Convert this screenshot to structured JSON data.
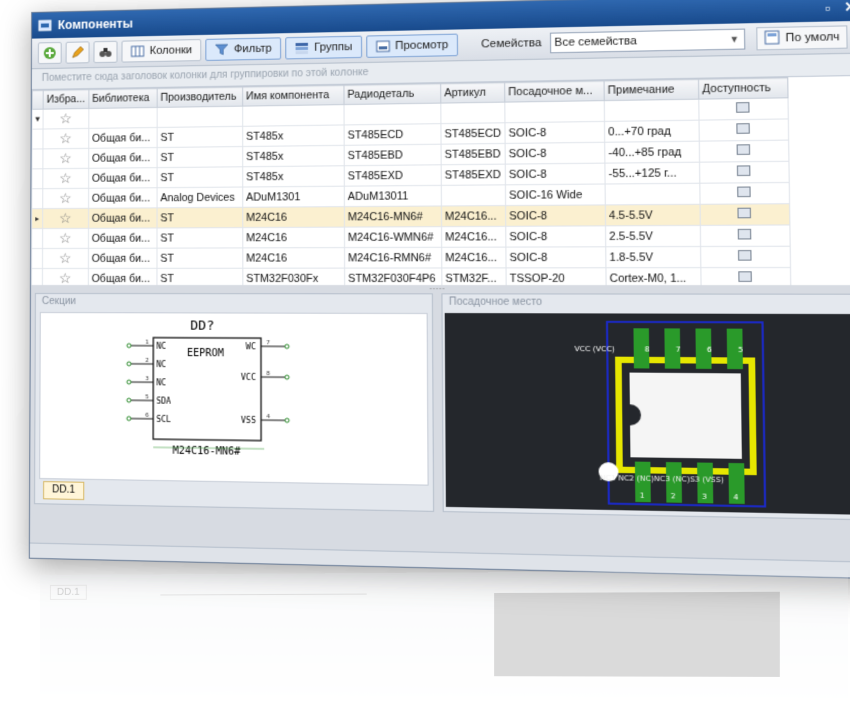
{
  "window": {
    "title": "Компоненты"
  },
  "toolbar": {
    "columns_label": "Колонки",
    "filter_label": "Фильтр",
    "groups_label": "Группы",
    "preview_label": "Просмотр",
    "families_label": "Семейства",
    "families_value": "Все семейства",
    "default_label": "По умолч"
  },
  "grid": {
    "group_hint": "Поместите сюда заголовок колонки для группировки по этой колонке",
    "columns": [
      "Избра...",
      "Библиотека",
      "Производитель",
      "Имя компонента",
      "Радиодеталь",
      "Артикул",
      "Посадочное м...",
      "Примечание",
      "Доступность"
    ],
    "rows": [
      [
        "Общая би...",
        "ST",
        "ST485x",
        "ST485ECD",
        "ST485ECD",
        "SOIC-8",
        "0...+70 град"
      ],
      [
        "Общая би...",
        "ST",
        "ST485x",
        "ST485EBD",
        "ST485EBD",
        "SOIC-8",
        "-40...+85 град"
      ],
      [
        "Общая би...",
        "ST",
        "ST485x",
        "ST485EXD",
        "ST485EXD",
        "SOIC-8",
        "-55...+125 г..."
      ],
      [
        "Общая би...",
        "Analog Devices",
        "ADuM1301",
        "ADuM13011",
        "",
        "SOIC-16 Wide",
        ""
      ],
      [
        "Общая би...",
        "ST",
        "M24C16",
        "M24C16-MN6#",
        "M24C16...",
        "SOIC-8",
        "4.5-5.5V"
      ],
      [
        "Общая би...",
        "ST",
        "M24C16",
        "M24C16-WMN6#",
        "M24C16...",
        "SOIC-8",
        "2.5-5.5V"
      ],
      [
        "Общая би...",
        "ST",
        "M24C16",
        "M24C16-RMN6#",
        "M24C16...",
        "SOIC-8",
        "1.8-5.5V"
      ],
      [
        "Общая би...",
        "ST",
        "STM32F030Fx",
        "STM32F030F4P6",
        "STM32F...",
        "TSSOP-20",
        "Cortex-M0, 1..."
      ]
    ],
    "selected_index": 4
  },
  "sections_panel": {
    "title": "Секции",
    "tab": "DD.1",
    "ref": "DD?",
    "chip_label": "EEPROM",
    "part_name": "M24C16-MN6#",
    "pins_left": [
      "NC",
      "NC",
      "NC",
      "SDA",
      "SCL"
    ],
    "pins_right": [
      "WC",
      "VCC",
      "VSS"
    ],
    "pin_nums_left": [
      "1",
      "2",
      "3",
      "5",
      "6"
    ],
    "pin_nums_right": [
      "7",
      "8",
      "4"
    ]
  },
  "footprint_panel": {
    "title": "Посадочное место",
    "top_pads": [
      {
        "num": "8",
        "net": "VCC (VCC)"
      },
      {
        "num": "7",
        "net": "WC"
      },
      {
        "num": "6",
        "net": "SCL"
      },
      {
        "num": "5",
        "net": "SDA"
      }
    ],
    "bottom_pads": [
      {
        "num": "1",
        "net": "NC"
      },
      {
        "num": "2",
        "net": "NC"
      },
      {
        "num": "3",
        "net": "NC"
      },
      {
        "num": "4",
        "net": "VSS"
      }
    ],
    "bottom_net_text": "NC1 NC2 (NC)NC3 (NC)S3 (VSS)"
  },
  "colors": {
    "title_bar": "#184a8c",
    "selected_row": "#fbf0d0",
    "pcb_background": "#24272c",
    "pad_green": "#2a9a2a",
    "silkscreen_yellow": "#e6e600",
    "outline_blue": "#1b2bd0"
  }
}
